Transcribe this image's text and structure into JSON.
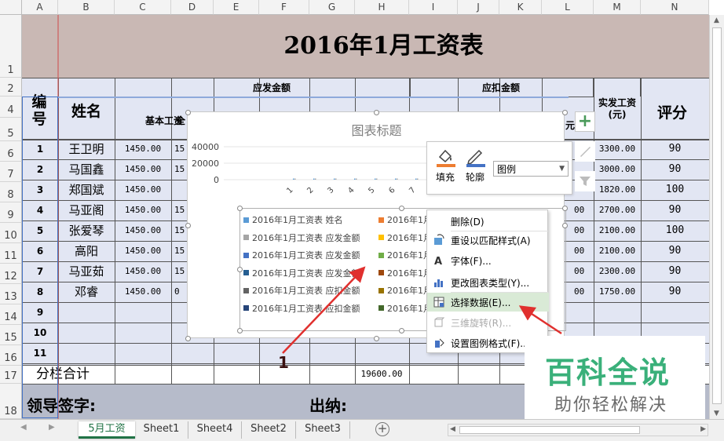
{
  "colors": {
    "title_bg": "#c9b8b4",
    "header_bg": "#e2e6f3",
    "grid_line": "#555555",
    "accent_green": "#217346",
    "menu_highlight": "#d9ead6",
    "arrow_red": "#e0302e"
  },
  "columns": [
    "A",
    "B",
    "C",
    "D",
    "E",
    "F",
    "G",
    "H",
    "I",
    "J",
    "K",
    "L",
    "M",
    "N"
  ],
  "rows": [
    "1",
    "2",
    "4",
    "5",
    "6",
    "7",
    "8",
    "9",
    "10",
    "11",
    "12",
    "13",
    "14",
    "15",
    "16",
    "17",
    "18"
  ],
  "sheet": {
    "title": "2016年1月工资表",
    "group_payable": "应发金额",
    "group_deduct": "应扣金额",
    "hdr_no": "编号",
    "hdr_name": "姓名",
    "hdr_base": "基本工资",
    "hdr_d_part": "全",
    "hdr_actual": "实发工资(元)",
    "hdr_score": "评分",
    "data": [
      {
        "no": "1",
        "name": "王卫明",
        "base": "1450.00",
        "d": "15",
        "actual": "3300.00",
        "score": "90"
      },
      {
        "no": "2",
        "name": "马国鑫",
        "base": "1450.00",
        "d": "15",
        "actual": "3000.00",
        "score": "90"
      },
      {
        "no": "3",
        "name": "郑国斌",
        "base": "1450.00",
        "d": "",
        "actual": "1820.00",
        "score": "100"
      },
      {
        "no": "4",
        "name": "马亚阁",
        "base": "1450.00",
        "d": "15",
        "actual": "2700.00",
        "score": "90"
      },
      {
        "no": "5",
        "name": "张爱琴",
        "base": "1450.00",
        "d": "15",
        "actual": "2100.00",
        "score": "100"
      },
      {
        "no": "6",
        "name": "高阳",
        "base": "1450.00",
        "d": "15",
        "actual": "2100.00",
        "score": "90"
      },
      {
        "no": "7",
        "name": "马亚茹",
        "base": "1450.00",
        "d": "15",
        "actual": "2300.00",
        "score": "90"
      },
      {
        "no": "8",
        "name": "邓睿",
        "base": "1450.00",
        "d": "0",
        "actual": "1750.00",
        "score": "90"
      }
    ],
    "extra_nos": [
      "9",
      "10",
      "11"
    ],
    "subtotal_label": "分栏合计",
    "subtotal_value": "19600.00",
    "sign_label": "领导签字:",
    "cashier_label": "出纳:",
    "partial_l": "00",
    "partial_actual_l": "元"
  },
  "chart": {
    "title": "图表标题",
    "yticks": [
      "40000",
      "20000",
      "0"
    ],
    "xticks": [
      "1",
      "2",
      "3",
      "4",
      "5",
      "6",
      "7"
    ],
    "legend_left": [
      {
        "label": "2016年1月工资表 姓名",
        "color": "#5b9bd5"
      },
      {
        "label": "2016年1月工资表 应发金额",
        "color": "#a5a5a5"
      },
      {
        "label": "2016年1月工资表 应发金额",
        "color": "#4472c4"
      },
      {
        "label": "2016年1月工资表 应发金额",
        "color": "#255e91"
      },
      {
        "label": "2016年1月工资表 应扣金额",
        "color": "#636363"
      },
      {
        "label": "2016年1月工资表 应扣金额",
        "color": "#264478"
      }
    ],
    "legend_right": [
      {
        "label": "2016年1月",
        "color": "#ed7d31"
      },
      {
        "label": "2016年1月",
        "color": "#ffc000"
      },
      {
        "label": "2016年1月",
        "color": "#70ad47"
      },
      {
        "label": "2016年1月",
        "color": "#9e480e"
      },
      {
        "label": "2016年1月",
        "color": "#997300"
      },
      {
        "label": "2016年1月",
        "color": "#43682b"
      }
    ]
  },
  "chart_data": {
    "type": "bar",
    "title": "图表标题",
    "categories": [
      "1",
      "2",
      "3",
      "4",
      "5",
      "6",
      "7"
    ],
    "ylim": [
      0,
      40000
    ],
    "yticks": [
      0,
      20000,
      40000
    ],
    "series": [
      {
        "name": "2016年1月工资表 姓名",
        "values": [
          0,
          0,
          0,
          0,
          0,
          0,
          0
        ]
      },
      {
        "name": "2016年1月工资表 应发金额",
        "values": [
          0,
          0,
          0,
          0,
          0,
          0,
          0
        ]
      }
    ]
  },
  "format_bar": {
    "fill_label": "填充",
    "outline_label": "轮廓",
    "dropdown_value": "图例"
  },
  "context_menu": {
    "items": [
      {
        "label": "删除(D)",
        "icon": "none",
        "enabled": true
      },
      {
        "label": "重设以匹配样式(A)",
        "icon": "reset-style-icon",
        "enabled": true
      },
      {
        "label": "字体(F)...",
        "icon": "font-icon",
        "enabled": true
      },
      {
        "label": "更改图表类型(Y)...",
        "icon": "change-chart-type-icon",
        "enabled": true
      },
      {
        "label": "选择数据(E)...",
        "icon": "select-data-icon",
        "enabled": true,
        "highlight": true
      },
      {
        "label": "三维旋转(R)...",
        "icon": "3d-rotation-icon",
        "enabled": false
      },
      {
        "label": "设置图例格式(F)...",
        "icon": "format-legend-icon",
        "enabled": true
      }
    ]
  },
  "annotation": {
    "number": "1"
  },
  "watermark": {
    "main": "百科全说",
    "sub": "助你轻松解决"
  },
  "tabs": [
    "5月工资",
    "Sheet1",
    "Sheet4",
    "Sheet2",
    "Sheet3"
  ],
  "plus_icon": "+"
}
